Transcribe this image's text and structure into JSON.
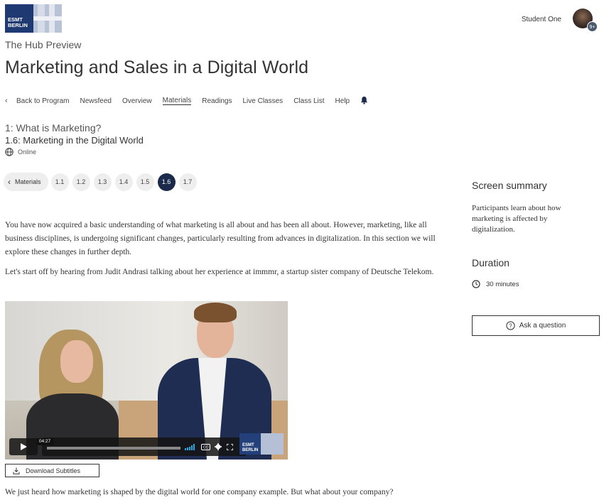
{
  "header": {
    "logo_line1": "ESMT",
    "logo_line2": "BERLIN",
    "user_name": "Student One",
    "avatar_badge": "9+"
  },
  "hub_label": "The Hub Preview",
  "course_title": "Marketing and Sales in a Digital World",
  "nav": {
    "items": [
      {
        "label": "Back to Program"
      },
      {
        "label": "Newsfeed"
      },
      {
        "label": "Overview"
      },
      {
        "label": "Materials",
        "active": true
      },
      {
        "label": "Readings"
      },
      {
        "label": "Live Classes"
      },
      {
        "label": "Class List"
      },
      {
        "label": "Help"
      }
    ]
  },
  "section": {
    "title": "1: What is Marketing?",
    "subtitle": "1.6: Marketing in the Digital World",
    "mode": "Online"
  },
  "pills": {
    "back_label": "Materials",
    "items": [
      "1.1",
      "1.2",
      "1.3",
      "1.4",
      "1.5",
      "1.6",
      "1.7"
    ],
    "active": "1.6"
  },
  "content": {
    "p1": "You have now acquired a basic understanding of what marketing is all about and has been all about. However, marketing, like all business disciplines, is undergoing significant changes, particularly resulting from advances in digitalization. In this section we will explore these changes in further depth.",
    "p2": "Let's start off by hearing from Judit Andrasi talking about her experience at immmr, a startup sister company of Deutsche Telekom.",
    "p3": "We just heard how marketing is shaped by the digital world for one company example. But what about your company?"
  },
  "video": {
    "time": "04:27",
    "logo_line1": "ESMT",
    "logo_line2": "BERLIN"
  },
  "download_subtitles": "Download Subtitles",
  "sidebar": {
    "summary_heading": "Screen summary",
    "summary_text": "Participants learn about how marketing is affected by digitalization.",
    "duration_heading": "Duration",
    "duration_value": "30 minutes",
    "ask_button": "Ask a question"
  },
  "colors": {
    "brand_navy": "#1f3a72",
    "active_pill": "#1b2a4a"
  }
}
